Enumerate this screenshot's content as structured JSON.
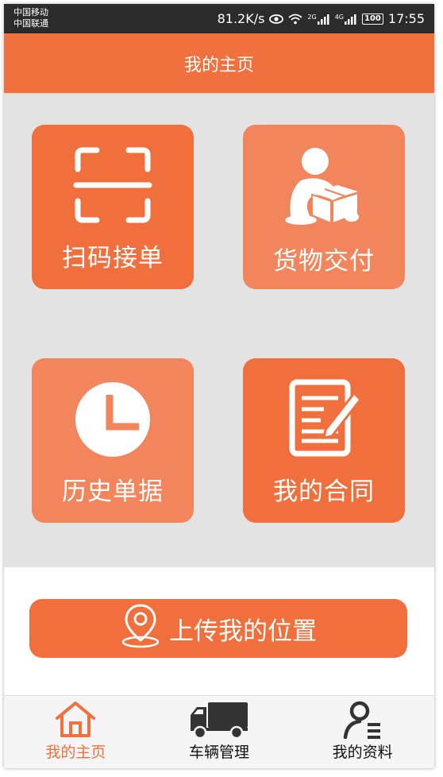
{
  "status_bar": {
    "carrier_1": "中国移动",
    "carrier_2": "中国联通",
    "network_speed": "81.2K/s",
    "sim1_label": "2G",
    "sim2_label": "4G",
    "battery": "100",
    "time": "17:55",
    "icons": [
      "eye-icon",
      "wifi-icon",
      "signal-icon",
      "battery-icon"
    ]
  },
  "header": {
    "title": "我的主页"
  },
  "tiles": [
    {
      "label": "扫码接单",
      "icon": "scan-icon"
    },
    {
      "label": "货物交付",
      "icon": "delivery-person-icon"
    },
    {
      "label": "历史单据",
      "icon": "clock-icon"
    },
    {
      "label": "我的合同",
      "icon": "contract-edit-icon"
    }
  ],
  "upload": {
    "label": "上传我的位置",
    "icon": "location-pin-icon"
  },
  "bottom_nav": {
    "items": [
      {
        "label": "我的主页",
        "icon": "home-icon",
        "active": true
      },
      {
        "label": "车辆管理",
        "icon": "truck-icon",
        "active": false
      },
      {
        "label": "我的资料",
        "icon": "profile-list-icon",
        "active": false
      }
    ]
  },
  "colors": {
    "accent": "#f0703e",
    "tile_light": "#f3855c",
    "grid_background": "#e3e3e3",
    "status_bar": "#2b2b2b"
  }
}
